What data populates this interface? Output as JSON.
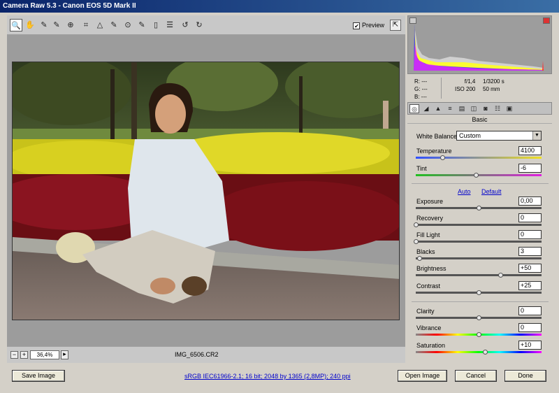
{
  "window": {
    "title": "Camera Raw 5.3  -  Canon EOS 5D Mark II"
  },
  "toolbar": {
    "tools": [
      {
        "name": "zoom-tool-icon",
        "glyph": "🔍"
      },
      {
        "name": "hand-tool-icon",
        "glyph": "✋"
      },
      {
        "name": "white-balance-tool-icon",
        "glyph": "✎"
      },
      {
        "name": "color-sampler-tool-icon",
        "glyph": "✎"
      },
      {
        "name": "target-adjustment-tool-icon",
        "glyph": "⊕"
      },
      {
        "name": "crop-tool-icon",
        "glyph": "⌗"
      },
      {
        "name": "straighten-tool-icon",
        "glyph": "△"
      },
      {
        "name": "spot-removal-tool-icon",
        "glyph": "✎"
      },
      {
        "name": "red-eye-tool-icon",
        "glyph": "⊙"
      },
      {
        "name": "adjustment-brush-icon",
        "glyph": "✎"
      },
      {
        "name": "graduated-filter-icon",
        "glyph": "▯"
      },
      {
        "name": "preferences-icon",
        "glyph": "☰"
      },
      {
        "name": "rotate-left-icon",
        "glyph": "↺"
      },
      {
        "name": "rotate-right-icon",
        "glyph": "↻"
      }
    ],
    "preview_label": "Preview",
    "preview_checked": "✔",
    "fullscreen_glyph": "⇱"
  },
  "status": {
    "zoom_out": "−",
    "zoom_in": "+",
    "zoom_value": "36,4%",
    "zoom_menu": "▸",
    "filename": "IMG_6506.CR2"
  },
  "readout": {
    "r": "R:   ---",
    "g": "G:   ---",
    "b": "B:   ---",
    "aperture": "f/1,4",
    "shutter": "1/3200 s",
    "iso": "ISO 200",
    "focal": "50 mm"
  },
  "panel": {
    "title": "Basic",
    "wb_label": "White Balance:",
    "wb_value": "Custom",
    "auto": "Auto",
    "default": "Default",
    "sliders": [
      {
        "label": "Temperature",
        "value": "4100",
        "pos": 0.21
      },
      {
        "label": "Tint",
        "value": "-6",
        "pos": 0.48
      },
      {
        "label": "Exposure",
        "value": "0,00",
        "pos": 0.5
      },
      {
        "label": "Recovery",
        "value": "0",
        "pos": 0.0
      },
      {
        "label": "Fill Light",
        "value": "0",
        "pos": 0.0
      },
      {
        "label": "Blacks",
        "value": "3",
        "pos": 0.03
      },
      {
        "label": "Brightness",
        "value": "+50",
        "pos": 0.67
      },
      {
        "label": "Contrast",
        "value": "+25",
        "pos": 0.5
      },
      {
        "label": "Clarity",
        "value": "0",
        "pos": 0.5
      },
      {
        "label": "Vibrance",
        "value": "0",
        "pos": 0.5
      },
      {
        "label": "Saturation",
        "value": "+10",
        "pos": 0.55
      }
    ]
  },
  "footer": {
    "save": "Save Image",
    "workflow": "sRGB IEC61966-2.1; 16 bit; 2048 by 1365 (2,8MP); 240 ppi",
    "open": "Open Image",
    "cancel": "Cancel",
    "done": "Done"
  }
}
